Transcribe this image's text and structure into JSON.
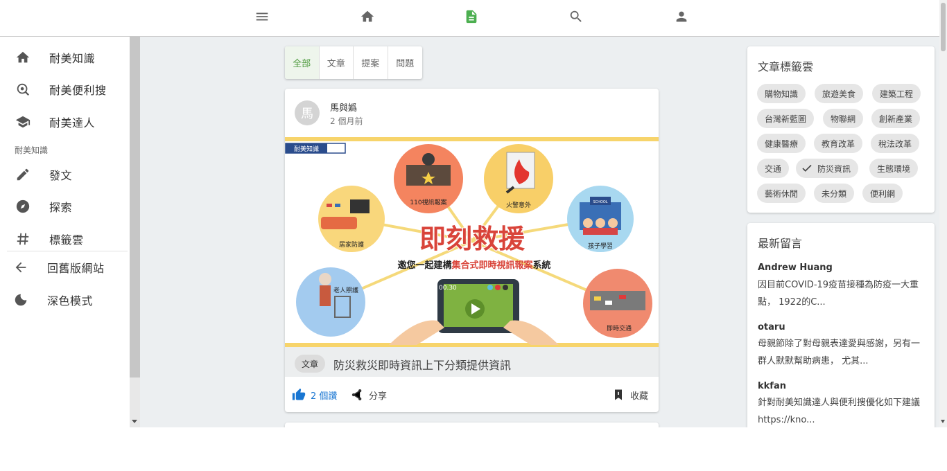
{
  "topnav": {
    "items": [
      {
        "icon": "menu-icon"
      },
      {
        "icon": "home-icon"
      },
      {
        "icon": "article-icon",
        "active": true
      },
      {
        "icon": "search-icon"
      },
      {
        "icon": "account-icon"
      }
    ],
    "active_color": "#4caf50"
  },
  "sidebar": {
    "items": [
      {
        "label": "耐美知識",
        "icon": "home-icon"
      },
      {
        "label": "耐美便利搜",
        "icon": "search-location-icon"
      },
      {
        "label": "耐美達人",
        "icon": "school-icon"
      }
    ],
    "section_title": "耐美知識",
    "section_items": [
      {
        "label": "發文",
        "icon": "pencil-icon"
      },
      {
        "label": "探索",
        "icon": "compass-icon"
      },
      {
        "label": "標籤雲",
        "icon": "hash-icon"
      }
    ],
    "footer_items": [
      {
        "label": "回舊版網站",
        "icon": "arrow-left-icon"
      },
      {
        "label": "深色模式",
        "icon": "moon-icon"
      }
    ]
  },
  "tabs": [
    {
      "label": "全部",
      "active": true
    },
    {
      "label": "文章"
    },
    {
      "label": "提案"
    },
    {
      "label": "問題"
    }
  ],
  "post": {
    "author": "馬與嬀",
    "avatar_initial": "馬",
    "time": "2 個月前",
    "banner": {
      "logo_text": "耐美知識",
      "headline": "即刻救援",
      "subline_prefix": "邀您一起建構",
      "subline_highlight": "集合式即時視訊報案",
      "subline_suffix": "系統",
      "video_time": "00.30",
      "circles": [
        "110視訊報案",
        "火警意外",
        "居家防護",
        "孩子學習",
        "老人照護",
        "即時交通"
      ],
      "school_sign": "SCHOOL"
    },
    "category": "文章",
    "title": "防災救災即時資訊上下分類提供資訊",
    "like_label": "2 個讚",
    "share_label": "分享",
    "bookmark_label": "收藏"
  },
  "tag_cloud": {
    "title": "文章標籤雲",
    "tags": [
      {
        "label": "購物知識"
      },
      {
        "label": "旅遊美食"
      },
      {
        "label": "建築工程"
      },
      {
        "label": "台灣新藍圖"
      },
      {
        "label": "物聯網"
      },
      {
        "label": "創新產業"
      },
      {
        "label": "健康醫療"
      },
      {
        "label": "教育改革"
      },
      {
        "label": "稅法改革"
      },
      {
        "label": "交通"
      },
      {
        "label": "防災資訊",
        "selected": true
      },
      {
        "label": "生態環境"
      },
      {
        "label": "藝術休閒"
      },
      {
        "label": "未分類"
      },
      {
        "label": "便利網"
      }
    ]
  },
  "comments": {
    "title": "最新留言",
    "items": [
      {
        "user": "Andrew Huang",
        "text": "因目前COVID-19疫苗接種為防疫一大重點， 1922的C..."
      },
      {
        "user": "otaru",
        "text": "母親節除了對母親表達愛與感謝，另有一群人默默幫助病患， 尤其..."
      },
      {
        "user": "kkfan",
        "text": "針對耐美知識達人與便利搜優化如下建議 https://kno..."
      }
    ]
  },
  "colors": {
    "accent_green": "#4caf50",
    "like_blue": "#1976d2",
    "background": "#eceff1"
  }
}
